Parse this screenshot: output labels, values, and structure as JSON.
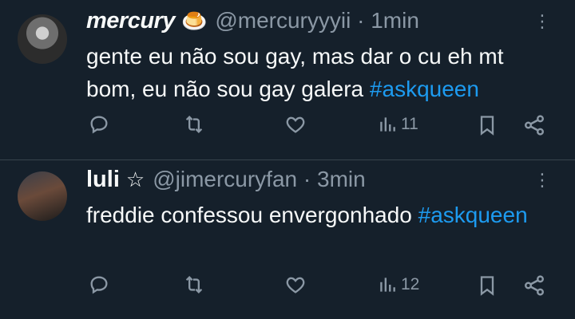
{
  "tweets": [
    {
      "name": "mercury",
      "emoji": "🍮",
      "handle": "@mercuryyyii",
      "time": "· 1min",
      "text_main": "gente eu não sou gay, mas dar o cu eh mt bom, eu não sou gay galera ",
      "hashtag": "#askqueen",
      "views": "11"
    },
    {
      "name": "luli",
      "emoji": "☆",
      "handle": "@jimercuryfan",
      "time": "· 3min",
      "text_main": "freddie confessou envergonhado ",
      "hashtag": "#askqueen",
      "views": "12"
    }
  ],
  "icons": [
    "reply-icon",
    "retweet-icon",
    "like-icon",
    "views-icon",
    "bookmark-icon",
    "share-icon",
    "more-icon"
  ],
  "colors": {
    "background": "#15202b",
    "text": "#f7f9f9",
    "muted": "#8b98a5",
    "link": "#1d9bf0",
    "divider": "#38444d"
  }
}
